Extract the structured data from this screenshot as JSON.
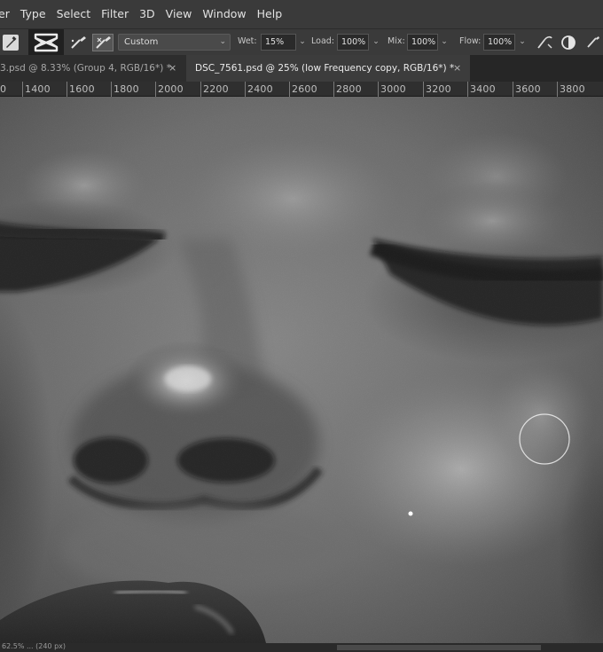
{
  "menu": [
    "er",
    "Type",
    "Select",
    "Filter",
    "3D",
    "View",
    "Window",
    "Help"
  ],
  "options": {
    "preset": "Custom",
    "wet_label": "Wet:",
    "wet_value": "15%",
    "load_label": "Load:",
    "load_value": "100%",
    "mix_label": "Mix:",
    "mix_value": "100%",
    "flow_label": "Flow:",
    "flow_value": "100%"
  },
  "tabs": [
    {
      "label": "3.psd @ 8.33% (Group 4, RGB/16*) *",
      "close": "×"
    },
    {
      "label": "DSC_7561.psd @ 25% (low Frequency copy, RGB/16*) *",
      "close": "×"
    }
  ],
  "ruler": [
    "0",
    "1400",
    "1600",
    "1800",
    "2000",
    "2200",
    "2400",
    "2600",
    "2800",
    "3000",
    "3200",
    "3400",
    "3600",
    "3800"
  ],
  "status": "62.5% ...  (240 px)",
  "icons": {
    "tool": "mixer-brush-icon",
    "logo": "capcut-logo-icon",
    "brush": "brush-icon",
    "clean": "clean-brush-icon",
    "sample": "sample-all-layers-icon",
    "pressure": "pressure-icon"
  },
  "colors": {
    "ui_dark": "#3a3a3a",
    "active_tab": "#3c3c3c",
    "canvas_skin": "#6a6a6a"
  }
}
